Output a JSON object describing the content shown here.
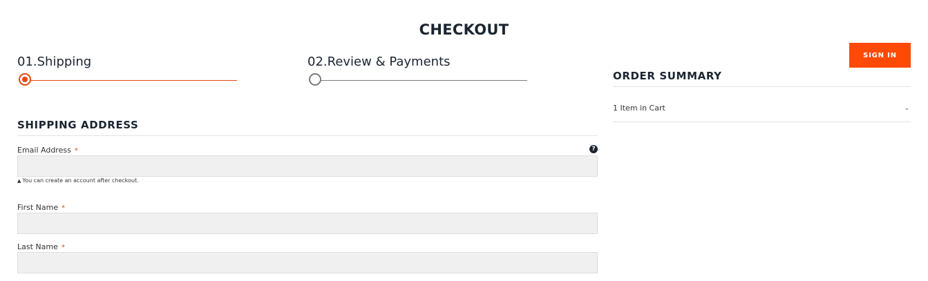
{
  "page": {
    "title": "CHECKOUT"
  },
  "steps": [
    {
      "label": "01.Shipping",
      "state": "active"
    },
    {
      "label": "02.Review & Payments",
      "state": "inactive"
    }
  ],
  "shipping": {
    "title": "SHIPPING ADDRESS",
    "required_marker": "*",
    "email": {
      "label": "Email Address",
      "value": "",
      "hint": "You can create an account after checkout.",
      "help_icon": "question-circle-icon"
    },
    "first_name": {
      "label": "First Name",
      "value": ""
    },
    "last_name": {
      "label": "Last Name",
      "value": ""
    }
  },
  "signin": {
    "label": "SIGN IN"
  },
  "summary": {
    "title": "ORDER SUMMARY",
    "cart_label": "1 Item in Cart",
    "chevron_icon": "chevron-down-icon"
  },
  "colors": {
    "accent": "#e8450f",
    "signin_bg": "#ff4a06",
    "input_bg": "#f0f0f1",
    "text": "#1b2530"
  }
}
